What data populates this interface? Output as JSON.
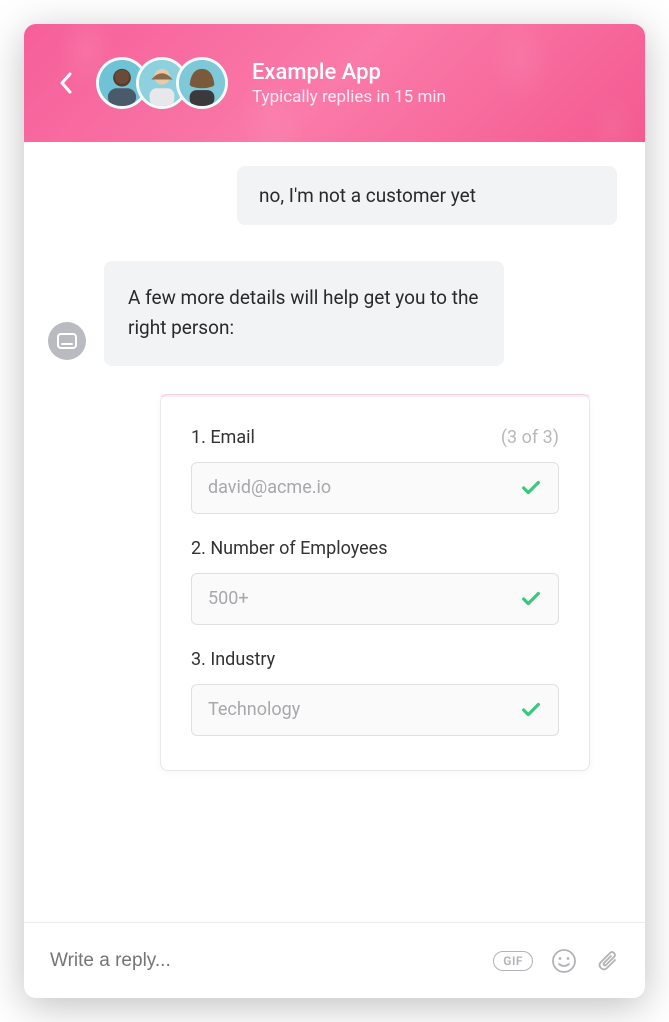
{
  "header": {
    "title": "Example App",
    "subtitle": "Typically replies in 15 min"
  },
  "messages": {
    "user1": "no, I'm not a customer yet",
    "bot1": "A few more details will help get you to the right person:"
  },
  "form": {
    "counter": "(3 of 3)",
    "fields": [
      {
        "label": "1. Email",
        "value": "david@acme.io"
      },
      {
        "label": "2. Number of Employees",
        "value": "500+"
      },
      {
        "label": "3. Industry",
        "value": "Technology"
      }
    ]
  },
  "composer": {
    "placeholder": "Write a reply...",
    "gif_label": "GIF"
  }
}
